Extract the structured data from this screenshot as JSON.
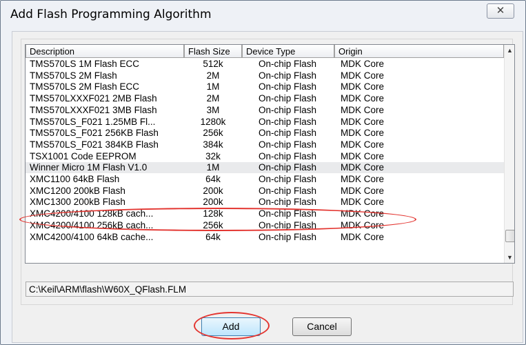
{
  "window": {
    "title": "Add Flash Programming Algorithm",
    "close_glyph": "✕"
  },
  "table": {
    "columns": [
      "Description",
      "Flash Size",
      "Device Type",
      "Origin"
    ],
    "rows": [
      {
        "description": "TMS570LS 1M Flash ECC",
        "size": "512k",
        "type": "On-chip Flash",
        "origin": "MDK Core"
      },
      {
        "description": "TMS570LS 2M Flash",
        "size": "2M",
        "type": "On-chip Flash",
        "origin": "MDK Core"
      },
      {
        "description": "TMS570LS 2M Flash ECC",
        "size": "1M",
        "type": "On-chip Flash",
        "origin": "MDK Core"
      },
      {
        "description": "TMS570LXXXF021 2MB Flash",
        "size": "2M",
        "type": "On-chip Flash",
        "origin": "MDK Core"
      },
      {
        "description": "TMS570LXXXF021 3MB Flash",
        "size": "3M",
        "type": "On-chip Flash",
        "origin": "MDK Core"
      },
      {
        "description": "TMS570LS_F021 1.25MB Fl...",
        "size": "1280k",
        "type": "On-chip Flash",
        "origin": "MDK Core"
      },
      {
        "description": "TMS570LS_F021 256KB Flash",
        "size": "256k",
        "type": "On-chip Flash",
        "origin": "MDK Core"
      },
      {
        "description": "TMS570LS_F021 384KB Flash",
        "size": "384k",
        "type": "On-chip Flash",
        "origin": "MDK Core"
      },
      {
        "description": "TSX1001 Code EEPROM",
        "size": "32k",
        "type": "On-chip Flash",
        "origin": "MDK Core"
      },
      {
        "description": "Winner Micro 1M Flash V1.0",
        "size": "1M",
        "type": "On-chip Flash",
        "origin": "MDK Core",
        "selected": true
      },
      {
        "description": "XMC1100 64kB Flash",
        "size": "64k",
        "type": "On-chip Flash",
        "origin": "MDK Core"
      },
      {
        "description": "XMC1200 200kB Flash",
        "size": "200k",
        "type": "On-chip Flash",
        "origin": "MDK Core"
      },
      {
        "description": "XMC1300 200kB Flash",
        "size": "200k",
        "type": "On-chip Flash",
        "origin": "MDK Core"
      },
      {
        "description": "XMC4200/4100 128kB cach...",
        "size": "128k",
        "type": "On-chip Flash",
        "origin": "MDK Core"
      },
      {
        "description": "XMC4200/4100 256kB cach...",
        "size": "256k",
        "type": "On-chip Flash",
        "origin": "MDK Core"
      },
      {
        "description": "XMC4200/4100 64kB cache...",
        "size": "64k",
        "type": "On-chip Flash",
        "origin": "MDK Core"
      }
    ]
  },
  "path": "C:\\Keil\\ARM\\flash\\W60X_QFlash.FLM",
  "buttons": {
    "add": "Add",
    "cancel": "Cancel"
  },
  "scrollbar": {
    "up_icon": "scroll-up-arrow",
    "down_icon": "scroll-down-arrow"
  },
  "annotation_color": "#e3342f"
}
